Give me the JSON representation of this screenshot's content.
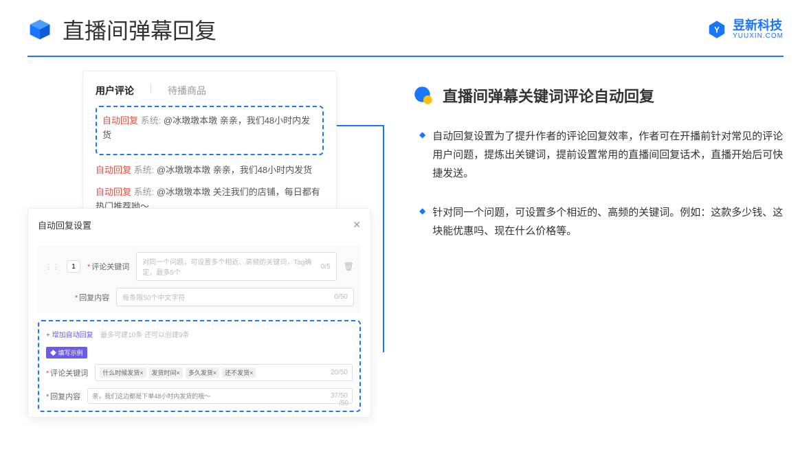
{
  "header": {
    "title": "直播间弹幕回复"
  },
  "brand": {
    "cn": "昱新科技",
    "en": "YUUXIN.COM"
  },
  "card1": {
    "tabs": {
      "active": "用户评论",
      "inactive": "待播商品"
    },
    "highlighted": {
      "prefix": "自动回复",
      "system": "系统:",
      "text": "@冰墩墩本墩 亲亲，我们48小时内发货"
    },
    "lines": [
      {
        "prefix": "自动回复",
        "system": "系统:",
        "text": "@冰墩墩本墩 亲亲，我们48小时内发货"
      },
      {
        "prefix": "自动回复",
        "system": "系统:",
        "text": "@冰墩墩本墩 关注我们的店铺，每日都有热门推荐呦～"
      }
    ]
  },
  "card2": {
    "title": "自动回复设置",
    "num": "1",
    "labels": {
      "keyword": "评论关键词",
      "content": "回复内容"
    },
    "placeholders": {
      "keyword": "对同一个问题，可设置多个相近、高频的关键词，Tag确定，最多5个",
      "content": "每条限50个中文字符"
    },
    "counters": {
      "keyword": "0/5",
      "content": "0/50"
    },
    "addLink": "+ 增加自动回复",
    "addHint": "最多可建10条 还可以创建9条",
    "exampleTag": "◆ 填写示例",
    "exKeywordChips": [
      "什么时候发货×",
      "发货时间×",
      "多久发货×",
      "还不发货×"
    ],
    "exKeywordCount": "20/50",
    "exContent": "亲，我们这边都是下单48小时内发货的哦～",
    "exContentCount": "37/50",
    "stray": "/50"
  },
  "section": {
    "title": "直播间弹幕关键词评论自动回复",
    "bullets": [
      "自动回复设置为了提升作者的评论回复效率，作者可在开播前针对常见的评论用户问题，提炼出关键词，提前设置常用的直播间回复话术，直播开始后可快捷发送。",
      "针对同一个问题，可设置多个相近的、高频的关键词。例如：这款多少钱、这块能优惠吗、现在什么价格等。"
    ]
  }
}
